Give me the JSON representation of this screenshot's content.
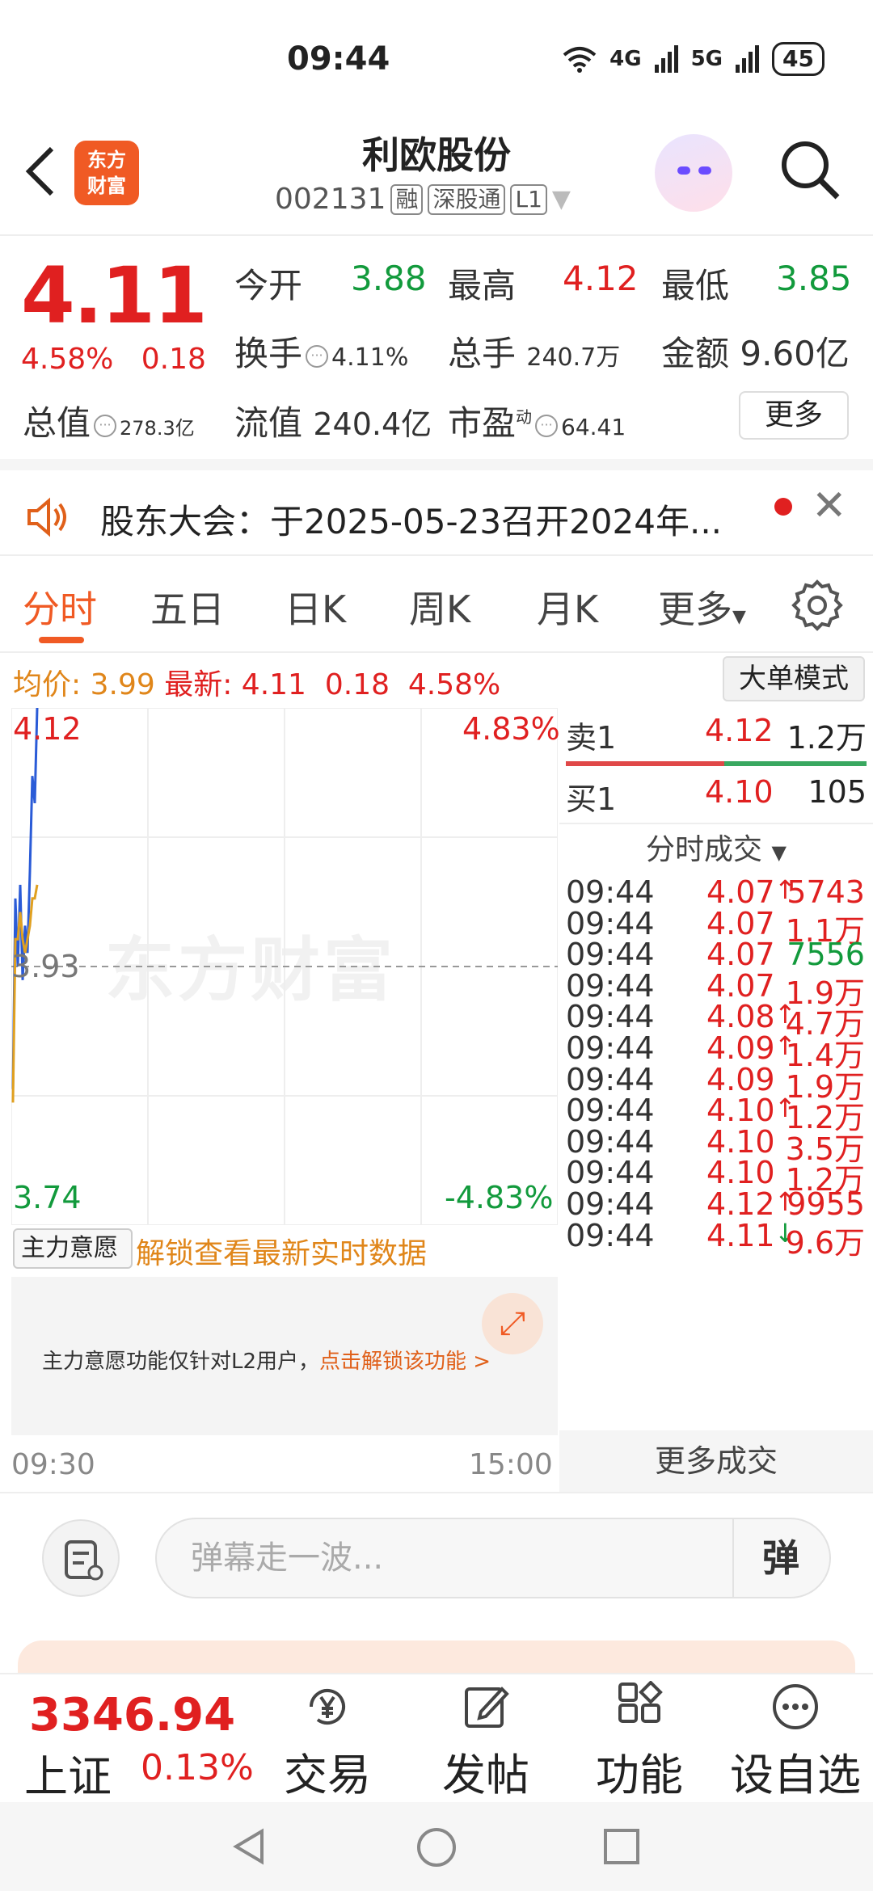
{
  "status_bar": {
    "time": "09:44",
    "net1": "4G",
    "net2": "5G",
    "battery": "45"
  },
  "header": {
    "logo_line1": "东方",
    "logo_line2": "财富",
    "stock_name": "利欧股份",
    "stock_code": "002131",
    "tags": [
      "融",
      "深股通",
      "L1"
    ]
  },
  "quote": {
    "price": "4.11",
    "change_pct": "4.58%",
    "change": "0.18",
    "open_label": "今开",
    "open": "3.88",
    "high_label": "最高",
    "high": "4.12",
    "low_label": "最低",
    "low": "3.85",
    "turnover_label": "换手",
    "turnover": "4.11%",
    "volume_label": "总手",
    "volume": "240.7万",
    "amount_label": "金额",
    "amount": "9.60亿",
    "mktcap_label": "总值",
    "mktcap": "278.3亿",
    "float_label": "流值",
    "float_cap": "240.4亿",
    "pe_label": "市盈",
    "pe_sup": "动",
    "pe": "64.41",
    "more_label": "更多"
  },
  "notice": {
    "text": "股东大会：于2025-05-23召开2024年..."
  },
  "tabs": {
    "items": [
      "分时",
      "五日",
      "日K",
      "周K",
      "月K",
      "更多"
    ],
    "active": "分时"
  },
  "summary": {
    "avg_label": "均价:",
    "avg": "3.99",
    "latest_label": "最新:",
    "latest": "4.11",
    "change": "0.18",
    "pct": "4.58%",
    "mode_button": "大单模式"
  },
  "chart_data": {
    "type": "line",
    "title": "",
    "y_top": "4.12",
    "y_mid": "3.93",
    "y_bottom": "3.74",
    "pct_top": "4.83%",
    "pct_bottom": "-4.83%",
    "x_start": "09:30",
    "x_end": "15:00",
    "ylim": [
      3.74,
      4.12
    ],
    "baseline": 3.93,
    "series": [
      {
        "name": "",
        "color": "#2a5bd7",
        "values": [
          3.84,
          3.98,
          3.93,
          3.99,
          3.92,
          3.96,
          3.94,
          4.0,
          4.07,
          4.05,
          4.12
        ]
      },
      {
        "name": "",
        "color": "#e0a020",
        "values": [
          3.83,
          3.95,
          3.95,
          3.97,
          3.95,
          3.94,
          3.95,
          3.96,
          3.98,
          3.98,
          3.99
        ]
      }
    ],
    "watermark": "东方财富"
  },
  "orderbook": {
    "sell1_label": "卖1",
    "sell1_price": "4.12",
    "sell1_vol": "1.2万",
    "buy1_label": "买1",
    "buy1_price": "4.10",
    "buy1_vol": "105",
    "trades_title": "分时成交",
    "trades": [
      {
        "time": "09:44",
        "price": "4.07",
        "dir": "up",
        "vol": "5743",
        "vcolor": "red"
      },
      {
        "time": "09:44",
        "price": "4.07",
        "dir": "",
        "vol": "1.1万",
        "vcolor": "red"
      },
      {
        "time": "09:44",
        "price": "4.07",
        "dir": "",
        "vol": "7556",
        "vcolor": "green"
      },
      {
        "time": "09:44",
        "price": "4.07",
        "dir": "",
        "vol": "1.9万",
        "vcolor": "red"
      },
      {
        "time": "09:44",
        "price": "4.08",
        "dir": "up",
        "vol": "4.7万",
        "vcolor": "red"
      },
      {
        "time": "09:44",
        "price": "4.09",
        "dir": "up",
        "vol": "1.4万",
        "vcolor": "red"
      },
      {
        "time": "09:44",
        "price": "4.09",
        "dir": "",
        "vol": "1.9万",
        "vcolor": "red"
      },
      {
        "time": "09:44",
        "price": "4.10",
        "dir": "up",
        "vol": "1.2万",
        "vcolor": "red"
      },
      {
        "time": "09:44",
        "price": "4.10",
        "dir": "",
        "vol": "3.5万",
        "vcolor": "red"
      },
      {
        "time": "09:44",
        "price": "4.10",
        "dir": "",
        "vol": "1.2万",
        "vcolor": "red"
      },
      {
        "time": "09:44",
        "price": "4.12",
        "dir": "up",
        "vol": "9955",
        "vcolor": "red"
      },
      {
        "time": "09:44",
        "price": "4.11",
        "dir": "down",
        "vol": "9.6万",
        "vcolor": "red"
      }
    ],
    "more_trades": "更多成交"
  },
  "main_will": {
    "select_label": "主力意愿",
    "unlock_text": "解锁查看最新实时数据",
    "panel_text": "主力意愿功能仅针对L2用户，",
    "panel_link": "点击解锁该功能 >"
  },
  "comment": {
    "placeholder": "弹幕走一波...",
    "danmu_button": "弹"
  },
  "index": {
    "value": "3346.94",
    "name": "上证",
    "pct": "0.13%"
  },
  "bottom_nav": [
    {
      "label": "交易",
      "icon": "yen-icon"
    },
    {
      "label": "发帖",
      "icon": "edit-icon"
    },
    {
      "label": "功能",
      "icon": "grid-icon"
    },
    {
      "label": "设自选",
      "icon": "more-dots-icon"
    }
  ]
}
